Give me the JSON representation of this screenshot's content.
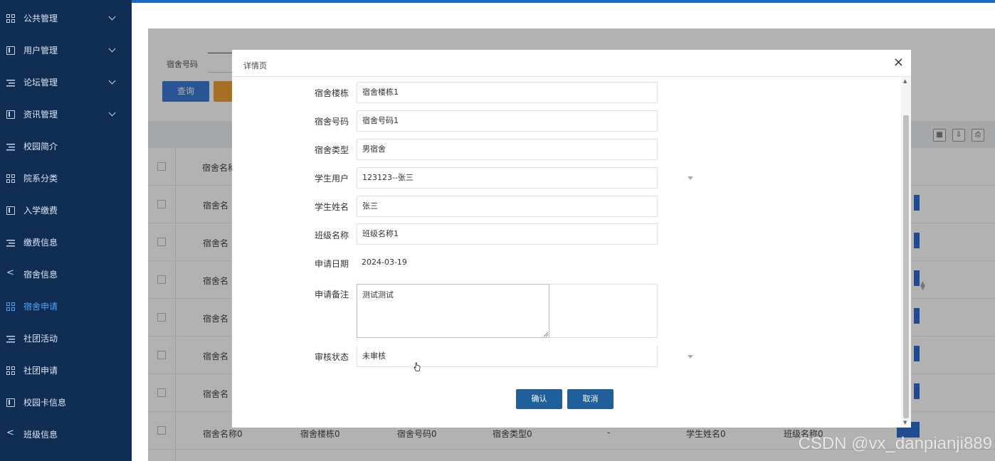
{
  "sidebar": {
    "items": [
      {
        "label": "公共管理",
        "icon": "grid-icon",
        "expandable": true
      },
      {
        "label": "用户管理",
        "icon": "book-icon",
        "expandable": true
      },
      {
        "label": "论坛管理",
        "icon": "list-icon",
        "expandable": true
      },
      {
        "label": "资讯管理",
        "icon": "book-icon",
        "expandable": true
      },
      {
        "label": "校园简介",
        "icon": "list-icon",
        "expandable": false
      },
      {
        "label": "院系分类",
        "icon": "grid-icon",
        "expandable": false
      },
      {
        "label": "入学缴费",
        "icon": "book-icon",
        "expandable": false
      },
      {
        "label": "缴费信息",
        "icon": "list-icon",
        "expandable": false
      },
      {
        "label": "宿舍信息",
        "icon": "share-icon",
        "expandable": false
      },
      {
        "label": "宿舍申请",
        "icon": "grid-icon",
        "expandable": false,
        "active": true
      },
      {
        "label": "社团活动",
        "icon": "list-icon",
        "expandable": false
      },
      {
        "label": "社团申请",
        "icon": "grid-icon",
        "expandable": false
      },
      {
        "label": "校园卡信息",
        "icon": "book-icon",
        "expandable": false
      },
      {
        "label": "班级信息",
        "icon": "share-icon",
        "expandable": false
      }
    ]
  },
  "search": {
    "label": "宿舍号码",
    "button": "查询"
  },
  "table": {
    "header_col": "宿舍名称",
    "rows": [
      "宿舍名",
      "宿舍名",
      "宿舍名",
      "宿舍名",
      "宿舍名",
      "宿舍名"
    ],
    "last_row": {
      "name": "宿舍名称0",
      "building": "宿舍楼栋0",
      "number": "宿舍号码0",
      "type": "宿舍类型0",
      "dash": "-",
      "student": "学生姓名0",
      "class": "班级名称0"
    }
  },
  "dialog": {
    "title": "详情页",
    "close": "×",
    "fields": {
      "building": {
        "label": "宿舍楼栋",
        "value": "宿舍楼栋1"
      },
      "number": {
        "label": "宿舍号码",
        "value": "宿舍号码1"
      },
      "type": {
        "label": "宿舍类型",
        "value": "男宿舍"
      },
      "user": {
        "label": "学生用户",
        "value": "123123--张三"
      },
      "student_name": {
        "label": "学生姓名",
        "value": "张三"
      },
      "class_name": {
        "label": "班级名称",
        "value": "班级名称1"
      },
      "apply_date": {
        "label": "申请日期",
        "value": "2024-03-19"
      },
      "remark": {
        "label": "申请备注",
        "value": "测试测试"
      },
      "status": {
        "label": "审核状态",
        "value": "未审核"
      }
    },
    "ok": "确认",
    "cancel": "取消"
  },
  "watermark": "CSDN @vx_danpianji889"
}
